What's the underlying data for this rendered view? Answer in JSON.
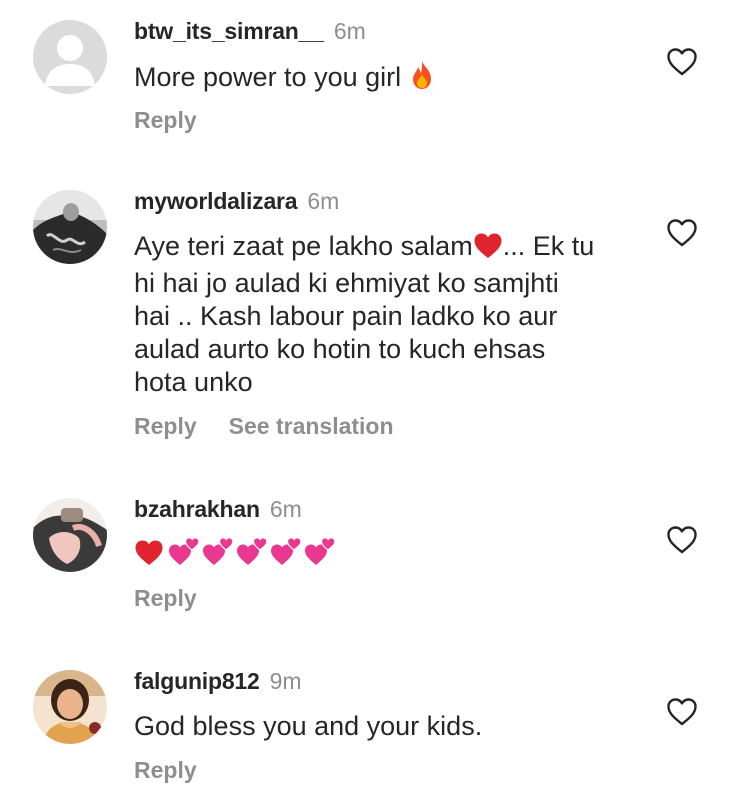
{
  "comments": [
    {
      "username": "btw_its_simran__",
      "time": "6m",
      "text": "More power to you girl",
      "emoji": "fire-icon",
      "reply_label": "Reply",
      "avatar": "default-avatar-icon"
    },
    {
      "username": "myworldalizara",
      "time": "6m",
      "text_lines": [
        "Aye teri zaat pe lakho salam",
        "... Ek tu",
        "hi hai jo aulad ki ehmiyat ko samjhti",
        "hai .. Kash labour pain ladko ko aur",
        "aulad aurto ko hotin to kuch ehsas",
        "hota unko"
      ],
      "emoji": "red-heart-icon",
      "reply_label": "Reply",
      "translation_label": "See translation",
      "avatar": "profile-photo"
    },
    {
      "username": "bzahrakhan",
      "time": "6m",
      "emojis": [
        "red-heart-icon",
        "two-hearts-icon",
        "two-hearts-icon",
        "two-hearts-icon",
        "two-hearts-icon",
        "two-hearts-icon"
      ],
      "reply_label": "Reply",
      "avatar": "profile-photo"
    },
    {
      "username": "falgunip812",
      "time": "9m",
      "text": "God bless you and your kids.",
      "reply_label": "Reply",
      "avatar": "profile-photo"
    }
  ],
  "like_icon": "heart-outline-icon",
  "colors": {
    "primary_text": "#262626",
    "secondary_text": "#8e8e8e",
    "heart_red": "#e0242f",
    "pink_heart": "#e8388f"
  }
}
